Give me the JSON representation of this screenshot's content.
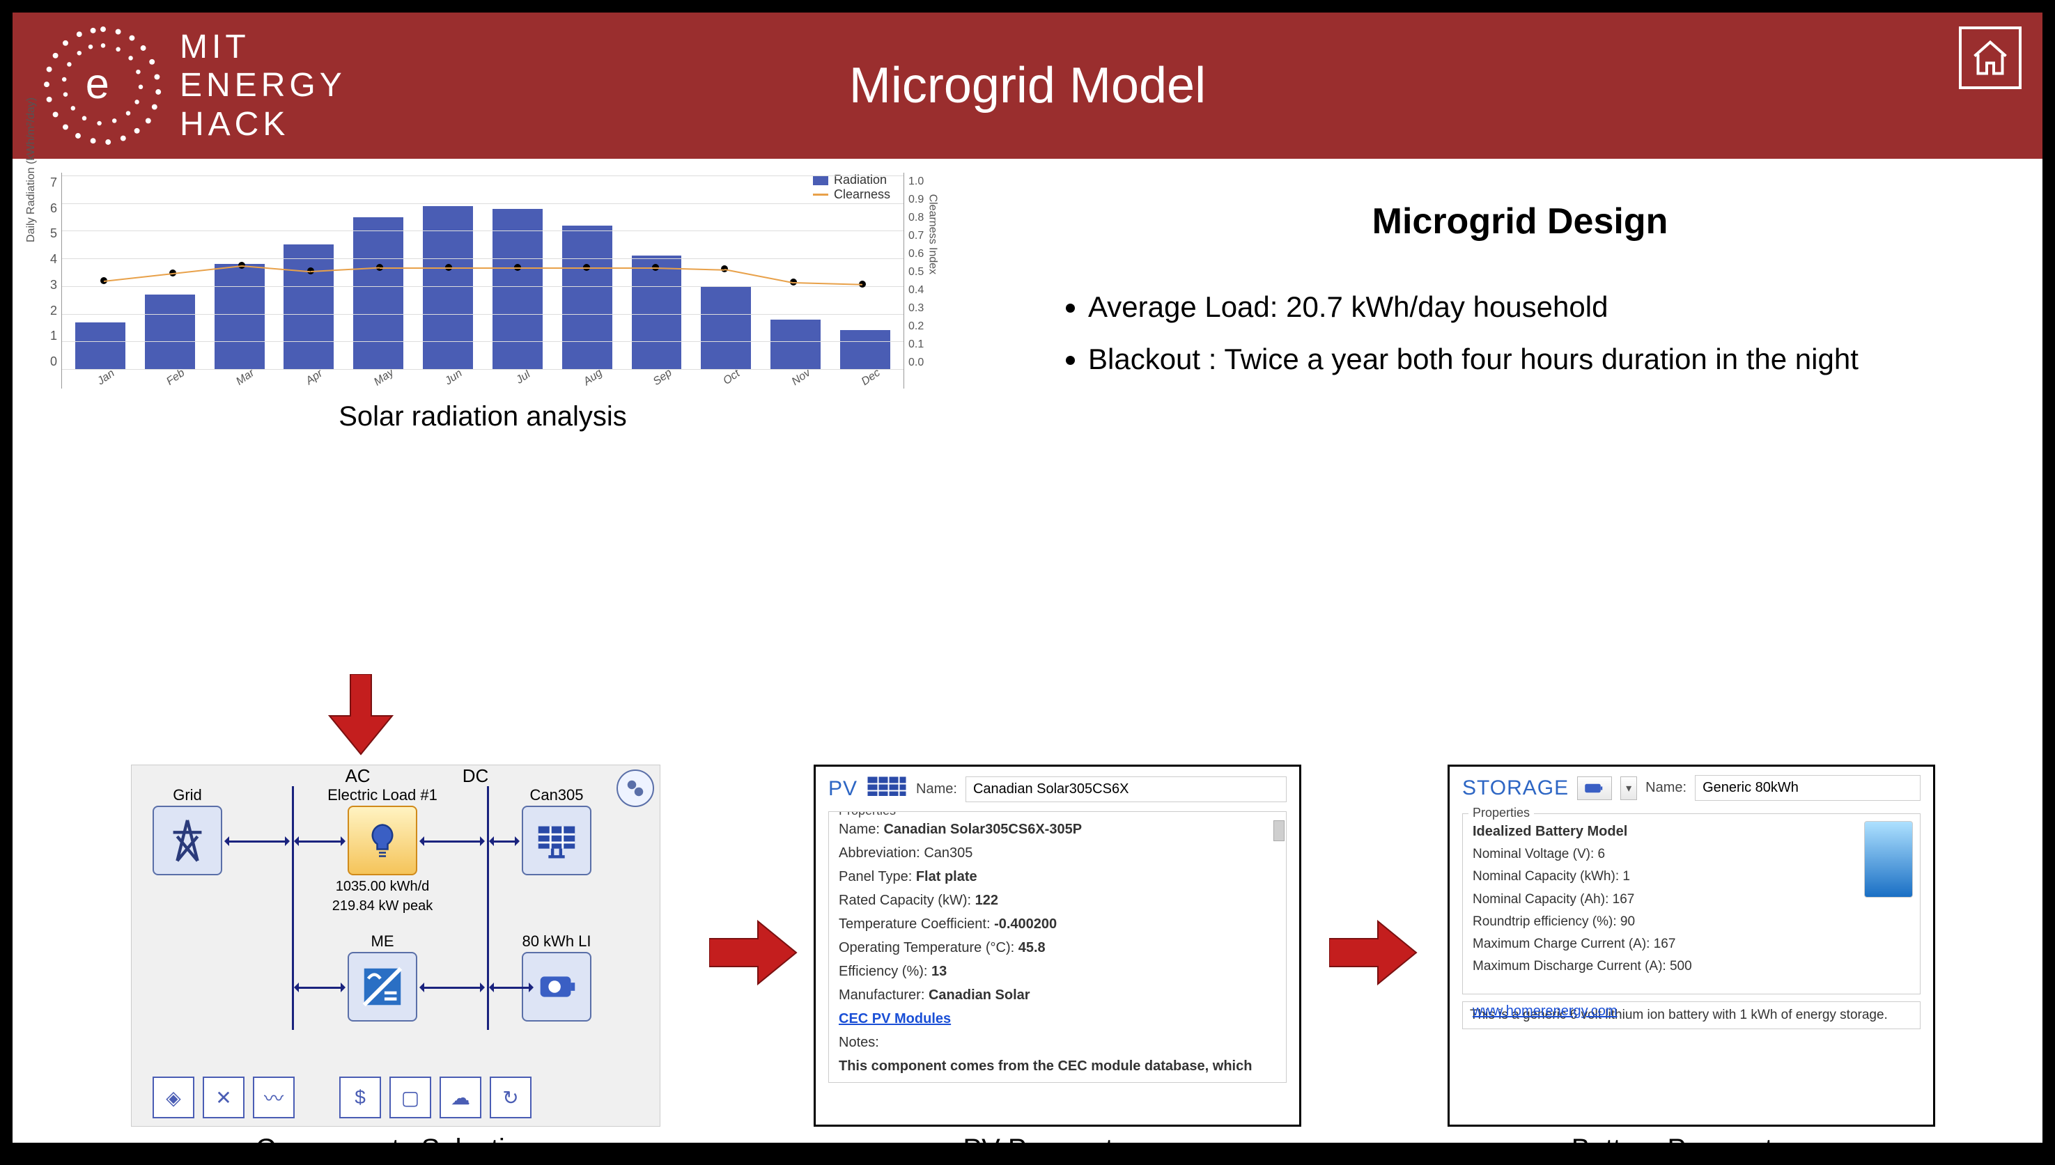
{
  "header": {
    "logo_lines": [
      "MIT",
      "ENERGY",
      "HACK"
    ],
    "title": "Microgrid Model"
  },
  "chart_data": {
    "type": "bar",
    "y_left_label": "Daily Radiation (kWh/m²/day)",
    "y_right_label": "Clearness Index",
    "ylim_left": [
      0,
      7
    ],
    "ylim_right": [
      0,
      1
    ],
    "categories": [
      "Jan",
      "Feb",
      "Mar",
      "Apr",
      "May",
      "Jun",
      "Jul",
      "Aug",
      "Sep",
      "Oct",
      "Nov",
      "Dec"
    ],
    "series": [
      {
        "name": "Radiation",
        "axis": "left",
        "values": [
          1.7,
          2.7,
          3.8,
          4.5,
          5.5,
          5.9,
          5.8,
          5.2,
          4.1,
          3.0,
          1.8,
          1.4
        ]
      },
      {
        "name": "Clearness",
        "axis": "right",
        "values": [
          0.45,
          0.49,
          0.53,
          0.5,
          0.52,
          0.52,
          0.52,
          0.52,
          0.52,
          0.51,
          0.44,
          0.43
        ]
      }
    ],
    "legend": [
      "Radiation",
      "Clearness"
    ]
  },
  "chart_caption": "Solar radiation analysis",
  "design": {
    "title": "Microgrid Design",
    "items": [
      "Average Load: 20.7 kWh/day household",
      "Blackout : Twice a year both four hours duration in the night"
    ]
  },
  "components": {
    "caption": "Components Selection",
    "headers": {
      "ac": "AC",
      "dc": "DC"
    },
    "grid": {
      "label": "Grid"
    },
    "load": {
      "label": "Electric Load #1",
      "under1": "1035.00 kWh/d",
      "under2": "219.84 kW peak"
    },
    "pv": {
      "label": "Can305"
    },
    "conv": {
      "label": "ME"
    },
    "batt": {
      "label": "80 kWh LI"
    }
  },
  "pv": {
    "caption": "PV Parameters",
    "heading": "PV",
    "name_label": "Name:",
    "name_value": "Canadian Solar305CS6X",
    "props_legend": "Properties",
    "rows": {
      "name_l": "Name:",
      "name_v": "Canadian Solar305CS6X-305P",
      "abbr_l": "Abbreviation:",
      "abbr_v": "Can305",
      "ptype_l": "Panel Type:",
      "ptype_v": "Flat plate",
      "cap_l": "Rated Capacity (kW):",
      "cap_v": "122",
      "tc_l": "Temperature Coefficient:",
      "tc_v": "-0.400200",
      "ot_l": "Operating Temperature (°C):",
      "ot_v": "45.8",
      "eff_l": "Efficiency (%):",
      "eff_v": "13",
      "mfr_l": "Manufacturer:",
      "mfr_v": "Canadian Solar",
      "link": "CEC PV Modules",
      "notes_l": "Notes:",
      "notes_v": "This component comes from the CEC module database, which was most recently updated in"
    }
  },
  "storage": {
    "caption": "Battery Parameters",
    "heading": "STORAGE",
    "name_label": "Name:",
    "name_value": "Generic 80kWh",
    "props_legend": "Properties",
    "model": "Idealized Battery Model",
    "rows": {
      "nv_l": "Nominal Voltage (V):",
      "nv_v": "6",
      "nck_l": "Nominal Capacity (kWh):",
      "nck_v": "1",
      "nca_l": "Nominal Capacity (Ah):",
      "nca_v": "167",
      "re_l": "Roundtrip efficiency (%):",
      "re_v": "90",
      "mcc_l": "Maximum Charge Current (A):",
      "mcc_v": "167",
      "mdc_l": "Maximum Discharge Current (A):",
      "mdc_v": "500"
    },
    "link": "www.homerenergy.com",
    "note": "This is a generic 6 volt lithium ion battery with 1 kWh of energy storage."
  }
}
